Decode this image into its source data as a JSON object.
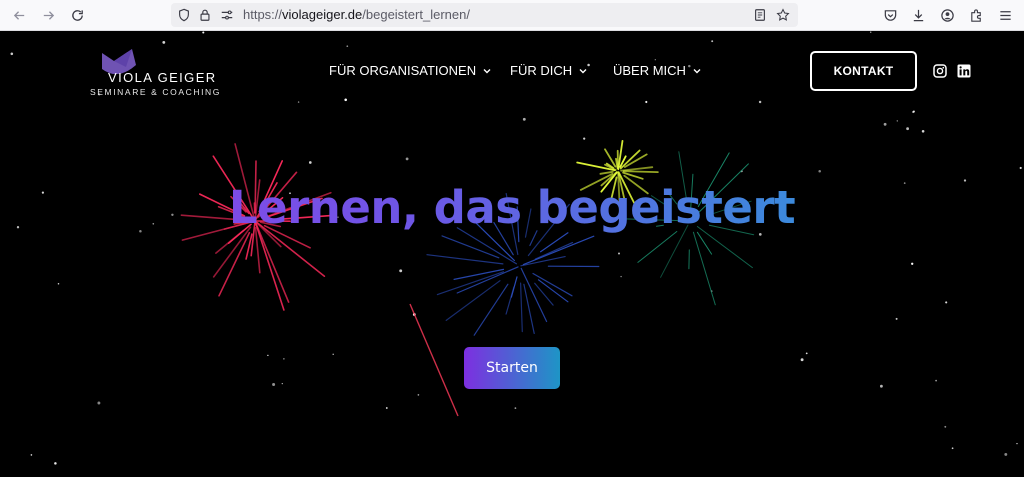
{
  "browser": {
    "url_domain": "violageiger.de",
    "url_path": "/begeistert_lernen/",
    "url_scheme": "https://"
  },
  "site": {
    "logo_name": "VIOLA GEIGER",
    "logo_sub": "SEMINARE & COACHING",
    "nav": [
      {
        "label": "FÜR ORGANISATIONEN"
      },
      {
        "label": "FÜR DICH"
      },
      {
        "label": "ÜBER MICH"
      }
    ],
    "contact_label": "KONTAKT"
  },
  "hero": {
    "title": "Lernen, das begeistert",
    "button_label": "Starten"
  },
  "colors": {
    "gradient_start": "#8e3fe8",
    "gradient_end": "#21a8d4",
    "logo_purple": "#7b5cc7"
  }
}
